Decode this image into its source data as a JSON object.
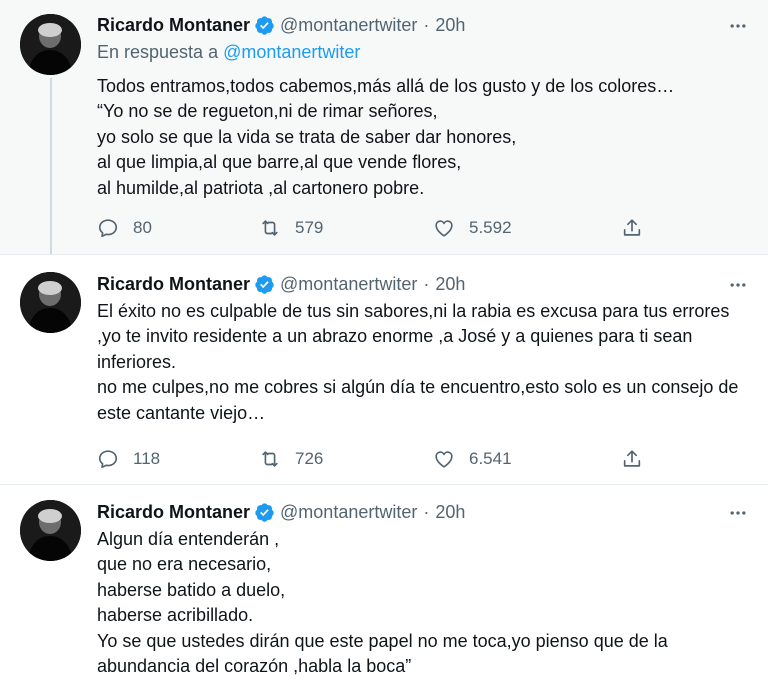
{
  "tweets": [
    {
      "author_name": "Ricardo Montaner",
      "handle": "@montanertwiter",
      "separator": "·",
      "time": "20h",
      "reply_prefix": "En respuesta a",
      "reply_mention": "@montanertwiter",
      "lines": [
        "Todos entramos,todos cabemos,más allá de los gusto y de los colores…",
        "“Yo no se de regueton,ni de rimar señores,",
        "yo solo se que la vida se trata de saber dar honores,",
        "al que limpia,al que barre,al que vende flores,",
        "al humilde,al patriota ,al cartonero pobre."
      ],
      "replies": "80",
      "retweets": "579",
      "likes": "5.592"
    },
    {
      "author_name": "Ricardo Montaner",
      "handle": "@montanertwiter",
      "separator": "·",
      "time": "20h",
      "lines": [
        "El éxito no es culpable de tus sin sabores,ni la rabia es excusa para tus errores ,yo te invito residente a un abrazo enorme ,a José y a quienes para ti sean inferiores.",
        "no me culpes,no me cobres si algún día te encuentro,esto solo es un consejo de este cantante viejo…"
      ],
      "replies": "118",
      "retweets": "726",
      "likes": "6.541"
    },
    {
      "author_name": "Ricardo Montaner",
      "handle": "@montanertwiter",
      "separator": "·",
      "time": "20h",
      "lines": [
        "Algun día entenderán ,",
        "que no era necesario,",
        "haberse batido a duelo,",
        "haberse acribillado.",
        "Yo se que ustedes dirán que este papel no me toca,yo pienso que de la",
        "abundancia del corazón ,habla la boca”"
      ]
    }
  ],
  "icons": {
    "verified": "verified-badge-icon",
    "more": "more-options-icon",
    "reply": "reply-icon",
    "retweet": "retweet-icon",
    "like": "heart-icon",
    "share": "share-icon"
  },
  "colors": {
    "accent": "#1d9bf0",
    "muted": "#536471",
    "text": "#0f1419",
    "highlight_bg": "#f7f9f9"
  }
}
